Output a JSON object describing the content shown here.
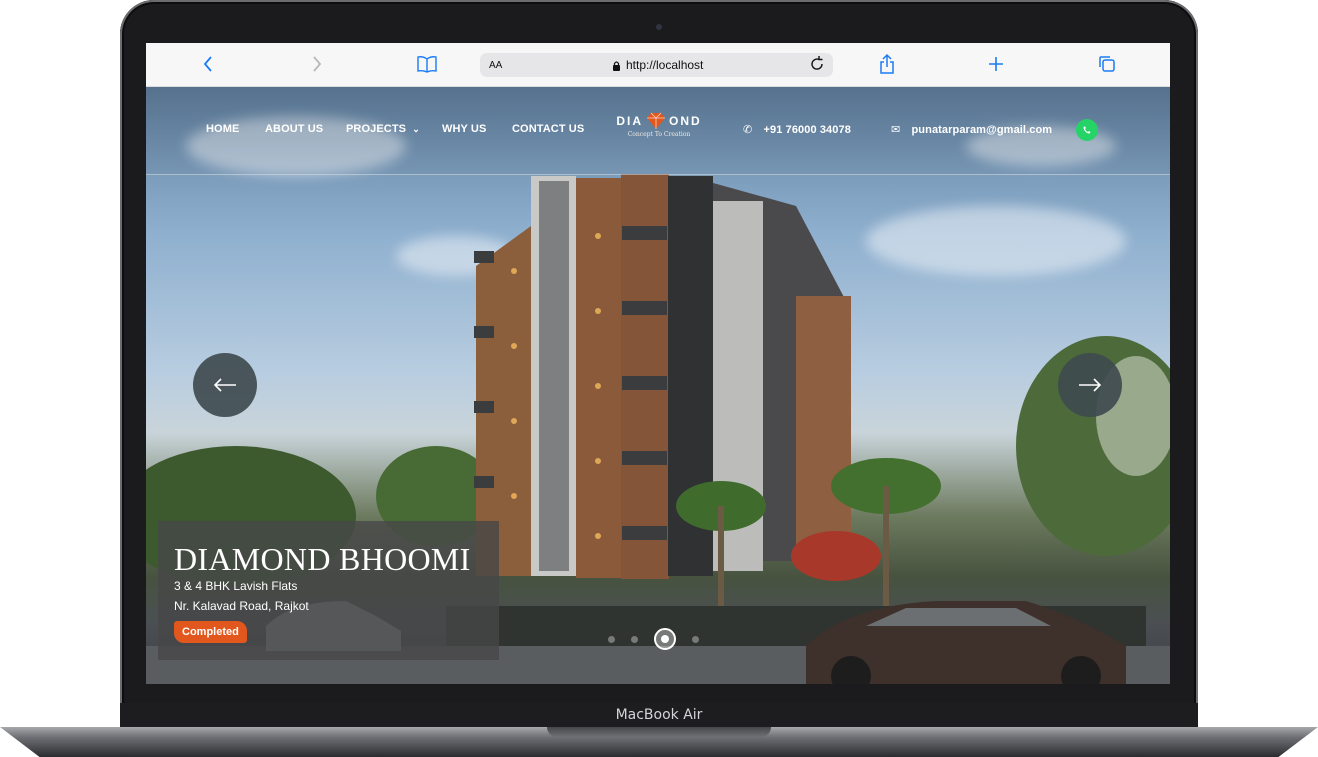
{
  "device": {
    "label": "MacBook Air"
  },
  "browser": {
    "text_size_label": "AA",
    "url": "http://localhost"
  },
  "nav": {
    "items": [
      "HOME",
      "ABOUT US",
      "PROJECTS",
      "WHY US",
      "CONTACT US"
    ],
    "logo_word_left": "DIA",
    "logo_word_right": "OND",
    "logo_tagline": "Concept To Creation",
    "phone": "+91 76000 34078",
    "email": "punatarparam@gmail.com"
  },
  "slide": {
    "title": "DIAMOND BHOOMI",
    "subtitle": "3 & 4 BHK Lavish Flats",
    "location": "Nr. Kalavad Road, Rajkot",
    "status": "Completed",
    "total_slides": 4,
    "active_index": 2
  },
  "colors": {
    "accent": "#e1571d",
    "safari_blue": "#1a7cf5",
    "arrow_bg": "#3f4b4f"
  }
}
